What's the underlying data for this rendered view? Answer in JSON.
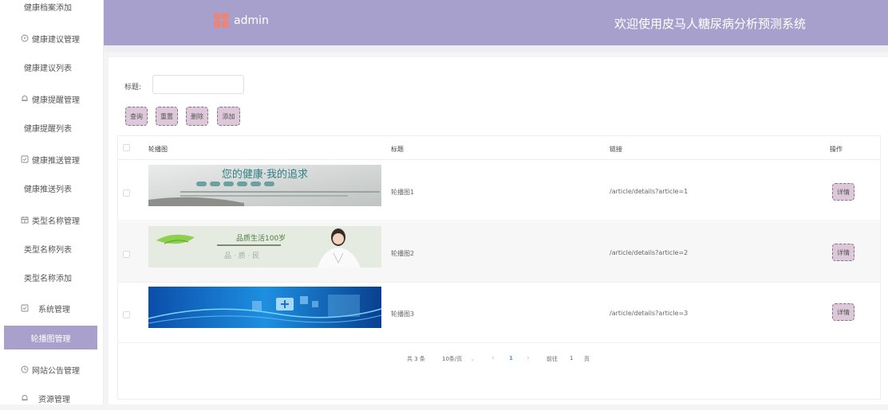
{
  "sidebar": {
    "items": [
      {
        "label": "健康档案添加",
        "type": "sub"
      },
      {
        "label": "健康建议管理",
        "type": "group",
        "icon": "compass-icon"
      },
      {
        "label": "健康建议列表",
        "type": "sub"
      },
      {
        "label": "健康提醒管理",
        "type": "group",
        "icon": "bell-icon"
      },
      {
        "label": "健康提醒列表",
        "type": "sub"
      },
      {
        "label": "健康推送管理",
        "type": "group",
        "icon": "checkbox-icon"
      },
      {
        "label": "健康推送列表",
        "type": "sub"
      },
      {
        "label": "类型名称管理",
        "type": "group",
        "icon": "grid-icon"
      },
      {
        "label": "类型名称列表",
        "type": "sub"
      },
      {
        "label": "类型名称添加",
        "type": "sub"
      },
      {
        "label": "系统管理",
        "type": "group",
        "icon": "checkbox-icon"
      },
      {
        "label": "轮播图管理",
        "type": "active"
      },
      {
        "label": "网站公告管理",
        "type": "group",
        "icon": "clock-icon"
      },
      {
        "label": "资源管理",
        "type": "group",
        "icon": "bell-icon"
      }
    ]
  },
  "header": {
    "logo_text": "admin",
    "title": "欢迎使用皮马人糖尿病分析预测系统"
  },
  "search": {
    "label": "标题:",
    "value": "",
    "placeholder": ""
  },
  "toolbar": {
    "query": "查询",
    "reset": "重置",
    "delete": "删除",
    "add": "添加"
  },
  "table": {
    "headers": {
      "image": "轮播图",
      "title": "标题",
      "link": "链接",
      "action": "操作"
    },
    "rows": [
      {
        "title": "轮播图1",
        "link": "/article/details?article=1",
        "action": "详情",
        "image_text": "您的健康·我的追求"
      },
      {
        "title": "轮播图2",
        "link": "/article/details?article=2",
        "action": "详情",
        "image_text": "品质生活100岁"
      },
      {
        "title": "轮播图3",
        "link": "/article/details?article=3",
        "action": "详情",
        "image_text": ""
      }
    ]
  },
  "pagination": {
    "total": "共 3 条",
    "page_size": "10条/页",
    "prev": "‹",
    "current": "1",
    "next": "›",
    "goto": "前往",
    "goto_value": "1",
    "page_suffix": "页"
  },
  "colors": {
    "accent": "#a8a0cc",
    "button_bg": "#dcc8d8",
    "active_page": "#409eff"
  }
}
